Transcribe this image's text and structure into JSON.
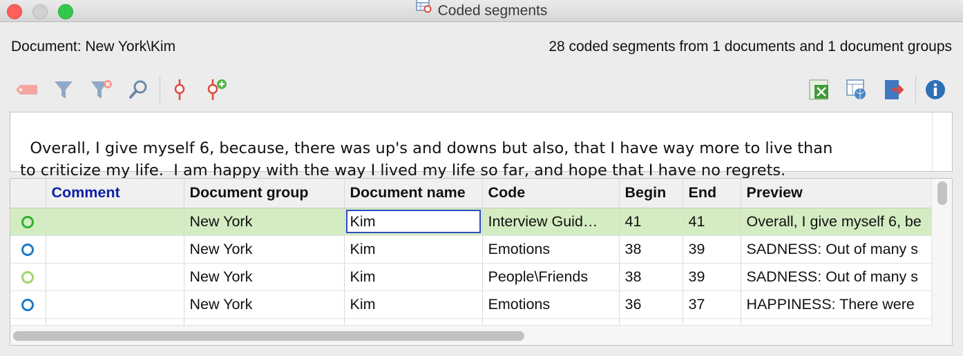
{
  "window": {
    "title": "Coded segments",
    "title_icon": "coded-segments-icon"
  },
  "header": {
    "document_label": "Document: New York\\Kim",
    "summary": "28 coded segments from 1 documents and 1 document groups"
  },
  "toolbar": {
    "left_icons": [
      "tag-icon",
      "filter-icon",
      "clear-filter-icon",
      "search-icon",
      "code-marker-icon",
      "new-code-icon"
    ],
    "right_icons": [
      "export-excel-icon",
      "export-html-icon",
      "export-icon",
      "info-icon"
    ]
  },
  "preview_text": "Overall, I give myself 6, because, there was up's and downs but also, that I have way more to live than\nto criticize my life.  I am happy with the way I lived my life so far, and hope that I have no regrets.",
  "table": {
    "columns": [
      "",
      "Comment",
      "Document group",
      "Document name",
      "Code",
      "Begin",
      "End",
      "Preview"
    ],
    "rows": [
      {
        "status_color": "#2fb12f",
        "comment": "",
        "group": "New York",
        "name": "Kim",
        "code": "Interview Guid…",
        "begin": "41",
        "end": "41",
        "preview": "Overall, I give myself 6, be"
      },
      {
        "status_color": "#1c78c8",
        "comment": "",
        "group": "New York",
        "name": "Kim",
        "code": "Emotions",
        "begin": "38",
        "end": "39",
        "preview": "SADNESS: Out of many s"
      },
      {
        "status_color": "#9fd66b",
        "comment": "",
        "group": "New York",
        "name": "Kim",
        "code": "People\\Friends",
        "begin": "38",
        "end": "39",
        "preview": "SADNESS: Out of many s"
      },
      {
        "status_color": "#1c78c8",
        "comment": "",
        "group": "New York",
        "name": "Kim",
        "code": "Emotions",
        "begin": "36",
        "end": "37",
        "preview": "HAPPINESS:  There were"
      }
    ],
    "selected_row": 0
  },
  "colors": {
    "selected_row_bg": "#d4ecc2",
    "comment_header": "#0b1fa8",
    "focus_border": "#2a4fbf"
  }
}
